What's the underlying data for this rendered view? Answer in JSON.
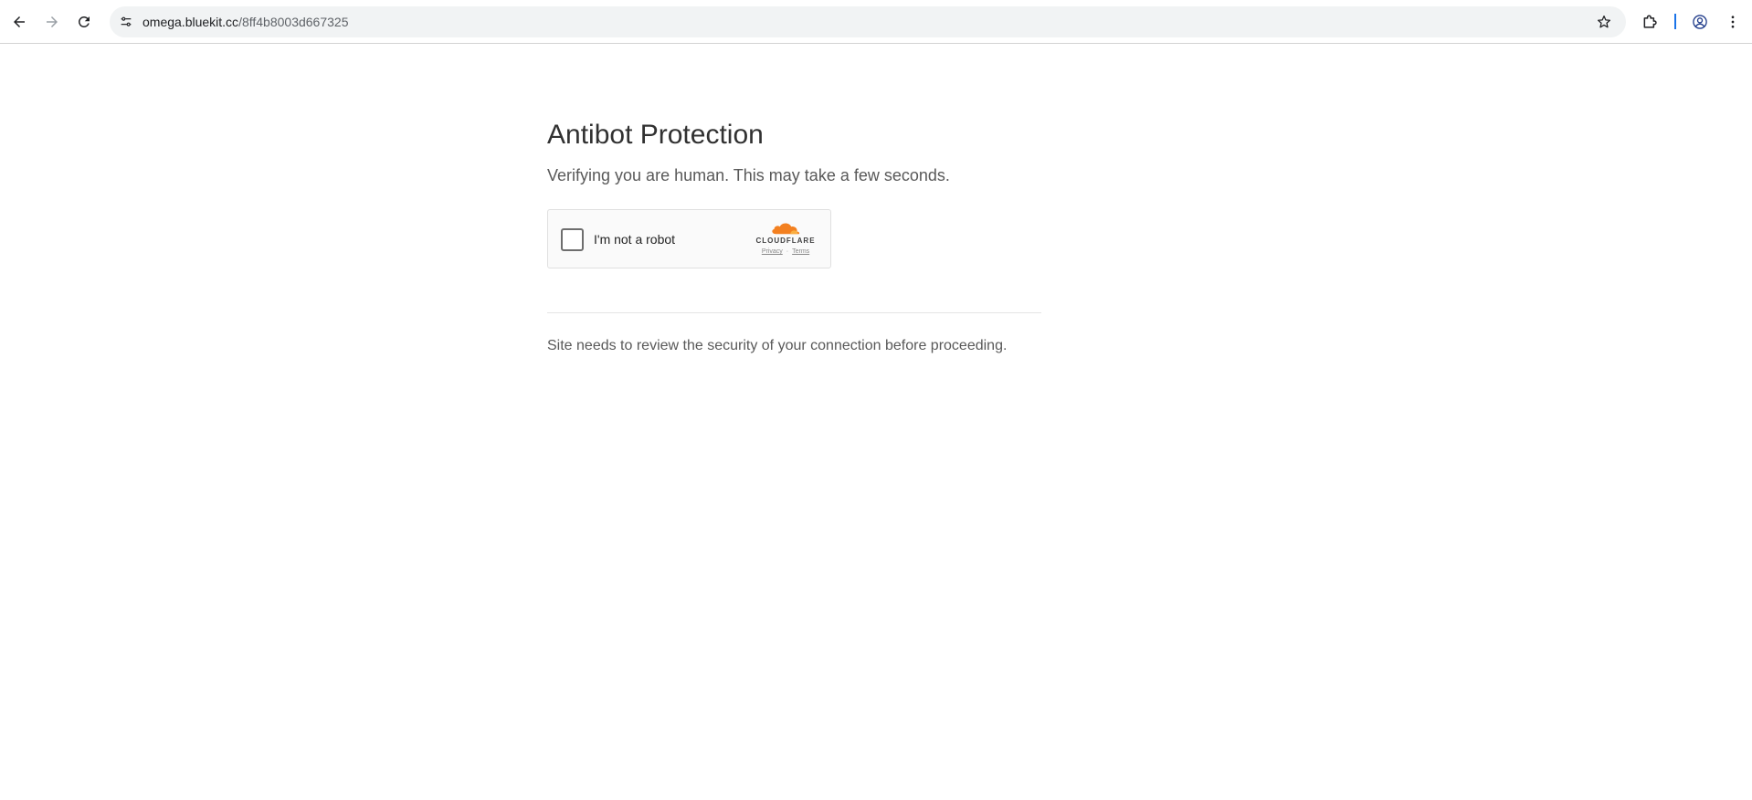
{
  "browser": {
    "url_host": "omega.bluekit.cc",
    "url_path": "/8ff4b8003d667325",
    "icons": {
      "back": "back-arrow-icon",
      "forward": "forward-arrow-icon",
      "reload": "reload-icon",
      "site_info": "tune-icon",
      "bookmark": "star-icon",
      "extensions": "puzzle-icon",
      "profile": "profile-icon",
      "menu": "kebab-menu-icon"
    }
  },
  "page": {
    "title": "Antibot Protection",
    "subtitle": "Verifying you are human. This may take a few seconds.",
    "captcha": {
      "label": "I'm not a robot",
      "brand": "CLOUDFLARE",
      "privacy": "Privacy",
      "separator": "·",
      "terms": "Terms",
      "brand_color": "#f38020"
    },
    "footnote": "Site needs to review the security of your connection before proceeding."
  }
}
